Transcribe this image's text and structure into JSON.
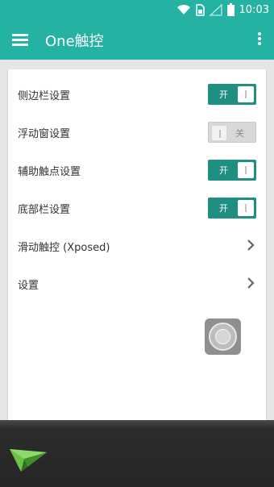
{
  "status_bar": {
    "time": "10:03"
  },
  "app_bar": {
    "title": "One触控"
  },
  "settings": [
    {
      "label": "侧边栏设置",
      "type": "switch",
      "state": "on",
      "switch_text": "开"
    },
    {
      "label": "浮动窗设置",
      "type": "switch",
      "state": "off",
      "switch_text": "关"
    },
    {
      "label": "辅助触点设置",
      "type": "switch",
      "state": "on",
      "switch_text": "开"
    },
    {
      "label": "底部栏设置",
      "type": "switch",
      "state": "on",
      "switch_text": "开"
    },
    {
      "label": "滑动触控 (Xposed)",
      "type": "link"
    },
    {
      "label": "设置",
      "type": "link"
    }
  ],
  "colors": {
    "accent": "#24b3a3",
    "switch_on": "#1f8f82",
    "switch_off": "#d8d8d8",
    "bottom_bar": "#262626",
    "logo_green": "#6cc24a"
  },
  "icons": [
    "wifi-icon",
    "sim-card-icon",
    "signal-icon",
    "battery-icon",
    "menu-icon",
    "more-vert-icon",
    "chevron-right-icon",
    "assistive-touch-icon",
    "paper-plane-logo-icon"
  ]
}
